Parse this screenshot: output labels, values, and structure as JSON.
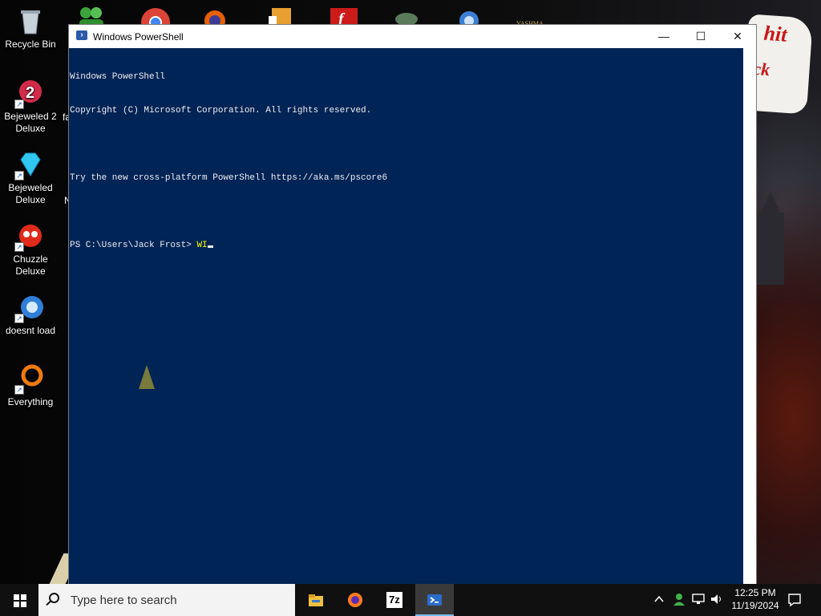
{
  "desktop": {
    "icons": [
      {
        "label": "Recycle Bin",
        "icon": "recycle-bin-icon"
      },
      {
        "label": "Bejeweled 2 Deluxe",
        "icon": "bejeweled2-icon"
      },
      {
        "label": "Bejeweled Deluxe",
        "icon": "bejeweled-icon"
      },
      {
        "label": "Chuzzle Deluxe",
        "icon": "chuzzle-icon"
      },
      {
        "label": "doesnt load",
        "icon": "thunderbird-icon"
      },
      {
        "label": "Everything",
        "icon": "everything-icon"
      }
    ],
    "top_icons": [
      "contacts-icon",
      "chrome-icon",
      "firefox-icon",
      "java-icon",
      "flash-icon",
      "game-icon",
      "thunderbird-icon",
      "yashma-icon"
    ],
    "wallpaper_texts": [
      "hit",
      "ck"
    ],
    "partial_labels": [
      "fa",
      "N"
    ]
  },
  "window": {
    "title": "Windows PowerShell",
    "minimize": "—",
    "maximize": "☐",
    "close": "✕",
    "console": {
      "lines": [
        "Windows PowerShell",
        "Copyright (C) Microsoft Corporation. All rights reserved.",
        "",
        "Try the new cross-platform PowerShell https://aka.ms/pscore6",
        ""
      ],
      "prompt": "PS C:\\Users\\Jack Frost> ",
      "command": "WI"
    }
  },
  "taskbar": {
    "search_placeholder": "Type here to search",
    "apps": [
      "file-explorer-icon",
      "firefox-icon",
      "7zip-icon",
      "powershell-icon"
    ],
    "app_7zip_label": "7z",
    "clock_time": "12:25 PM",
    "clock_date": "11/19/2024",
    "accent": "#76b9ed"
  },
  "colors": {
    "console_bg": "#012456",
    "console_fg": "#eeedf0",
    "command_fg": "#ffff00"
  }
}
